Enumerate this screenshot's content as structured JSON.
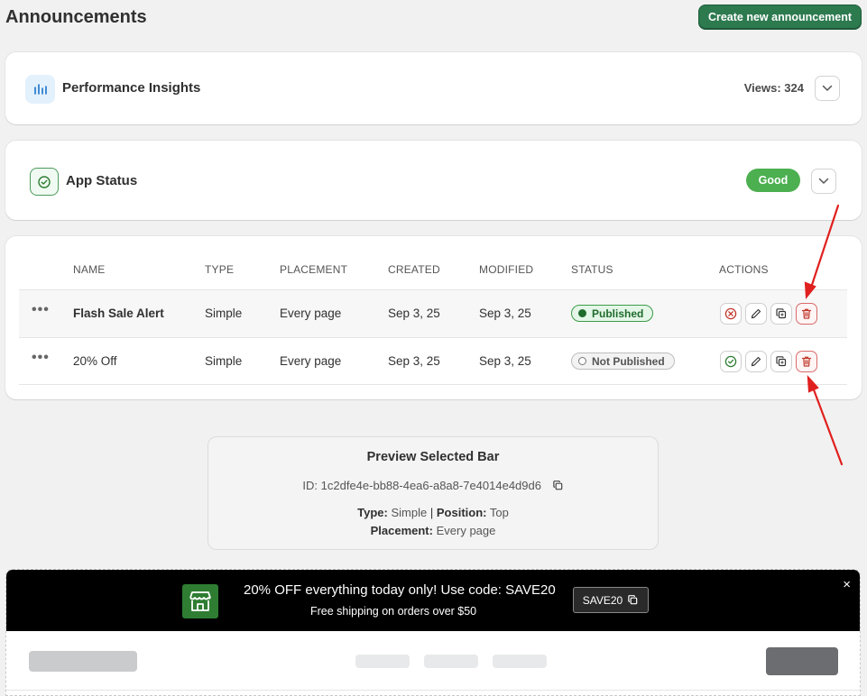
{
  "header": {
    "title": "Announcements",
    "create_button": "Create new announcement"
  },
  "performance": {
    "title": "Performance Insights",
    "views_label": "Views: 324",
    "icon": "bar-chart-icon"
  },
  "app_status": {
    "title": "App Status",
    "badge": "Good",
    "icon": "check-circle-icon"
  },
  "table": {
    "columns": [
      "NAME",
      "TYPE",
      "PLACEMENT",
      "CREATED",
      "MODIFIED",
      "STATUS",
      "ACTIONS"
    ],
    "rows": [
      {
        "menu": "•••",
        "name": "Flash Sale Alert",
        "type": "Simple",
        "placement": "Every page",
        "created": "Sep 3, 25",
        "modified": "Sep 3, 25",
        "status": "Published"
      },
      {
        "menu": "•••",
        "name": "20% Off",
        "type": "Simple",
        "placement": "Every page",
        "created": "Sep 3, 25",
        "modified": "Sep 3, 25",
        "status": "Not Published"
      }
    ]
  },
  "preview": {
    "title": "Preview Selected Bar",
    "id_label": "ID:",
    "id_value": "1c2dfe4e-bb88-4ea6-a8a8-7e4014e4d9d6",
    "type_label": "Type:",
    "type_value": "Simple",
    "separator": "|",
    "position_label": "Position:",
    "position_value": "Top",
    "placement_label": "Placement:",
    "placement_value": "Every page"
  },
  "announcement_bar": {
    "message": "20% OFF everything today only! Use code: SAVE20",
    "subtext": "Free shipping on orders over $50",
    "code": "SAVE20",
    "close": "×"
  },
  "colors": {
    "primary": "#2d7a4f",
    "good": "#4caf50",
    "published": "#1f6b2c",
    "danger": "#c0392b",
    "annotation_arrow": "#e0201f"
  }
}
